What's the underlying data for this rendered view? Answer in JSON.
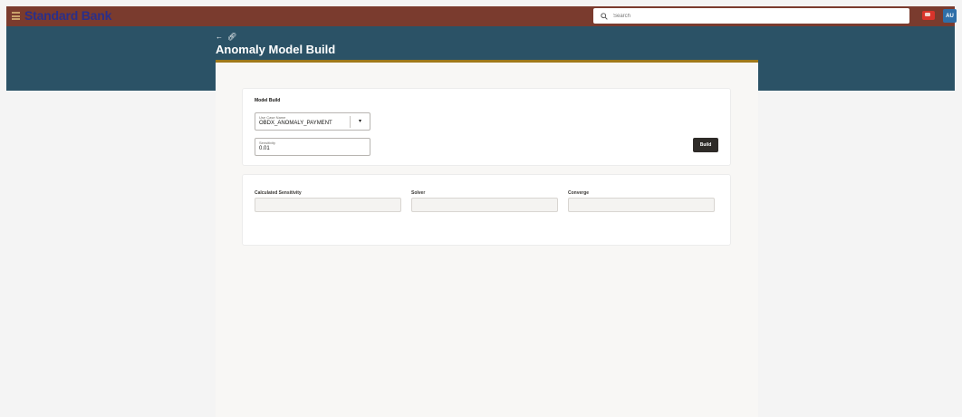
{
  "header": {
    "brand": "Standard Bank",
    "search_placeholder": "Search",
    "avatar_initials": "AU",
    "colors": {
      "topbar": "#7a3b2e",
      "hero": "#2b5266",
      "brand_text": "#2a2f8a",
      "accent_bar": "#a0791a"
    }
  },
  "page": {
    "title": "Anomaly Model Build",
    "back_icon": "arrow-left-icon",
    "link_icon": "link-icon"
  },
  "model_build": {
    "title": "Model Build",
    "use_case": {
      "label": "Use Case Name",
      "value": "OBDX_ANOMALY_PAYMENT"
    },
    "sensitivity": {
      "label": "Sensitivity",
      "value": "0.01"
    },
    "build_label": "Build"
  },
  "results": {
    "columns": [
      {
        "label": "Calculated Sensitivity",
        "value": ""
      },
      {
        "label": "Solver",
        "value": ""
      },
      {
        "label": "Converge",
        "value": ""
      }
    ]
  }
}
